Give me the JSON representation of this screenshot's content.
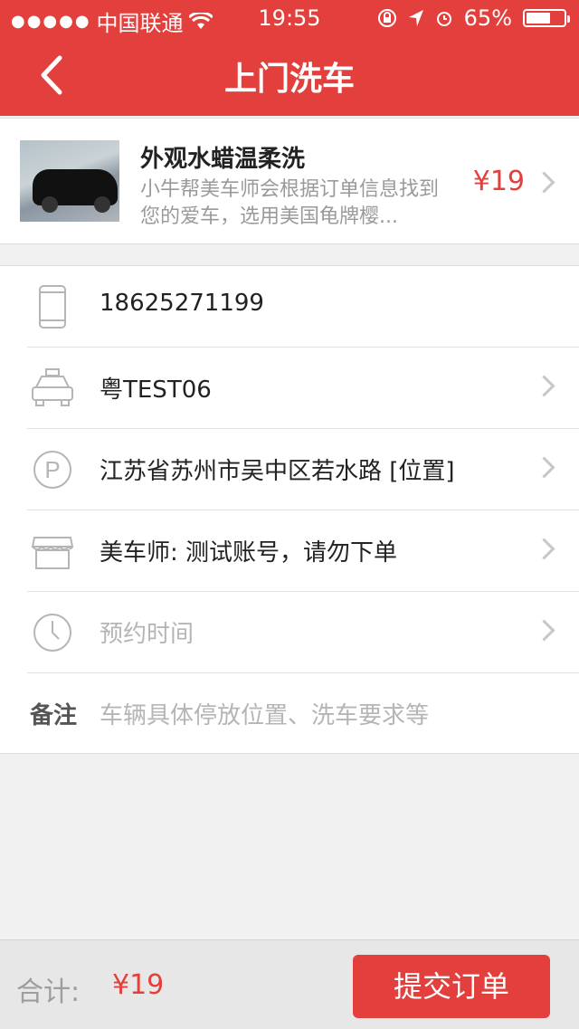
{
  "status_bar": {
    "carrier": "中国联通",
    "time": "19:55",
    "battery": "65%",
    "battery_level": 0.65
  },
  "nav": {
    "title": "上门洗车"
  },
  "service": {
    "name": "外观水蜡温柔洗",
    "description": "小牛帮美车师会根据订单信息找到您的爱车，选用美国龟牌樱...",
    "price": "¥19"
  },
  "form": {
    "phone": "18625271199",
    "plate": "粤TEST06",
    "address": "江苏省苏州市吴中区若水路 [位置]",
    "washer": "美车师: 测试账号，请勿下单",
    "time_placeholder": "预约时间",
    "note_label": "备注",
    "note_placeholder": "车辆具体停放位置、洗车要求等"
  },
  "footer": {
    "total_label": "合计:",
    "total_value": "¥19",
    "submit_label": "提交订单"
  },
  "colors": {
    "accent": "#e33f3c"
  }
}
